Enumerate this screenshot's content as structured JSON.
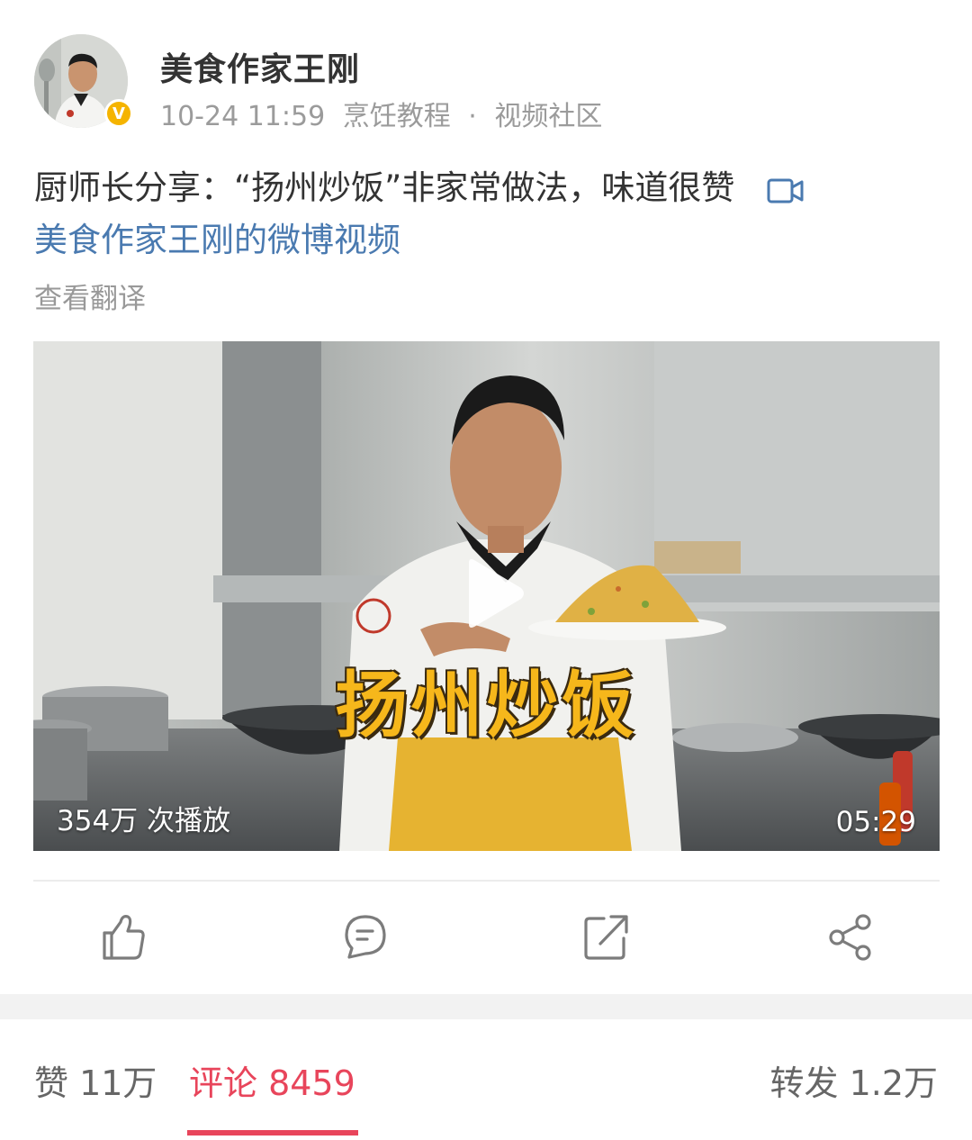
{
  "header": {
    "author_name": "美食作家王刚",
    "verified_badge": "V",
    "timestamp": "10-24 11:59",
    "category": "烹饪教程",
    "separator": "·",
    "source": "视频社区"
  },
  "post": {
    "text": "厨师长分享：“扬州炒饭”非家常做法，味道很赞",
    "video_link_label": "美食作家王刚的微博视频",
    "video_link_icon": "video-camera-icon",
    "translate_label": "查看翻译"
  },
  "video": {
    "title_overlay": "扬州炒饭",
    "play_count": "354万 次播放",
    "duration": "05:29"
  },
  "actions": [
    {
      "icon": "thumbs-up-icon"
    },
    {
      "icon": "comment-icon"
    },
    {
      "icon": "repost-icon"
    },
    {
      "icon": "share-icon"
    }
  ],
  "tabs": {
    "likes": "赞 11万",
    "comments": "评论 8459",
    "reposts": "转发 1.2万"
  },
  "colors": {
    "accent": "#e8455b",
    "link": "#4a7ab0",
    "verified": "#f5b400"
  }
}
